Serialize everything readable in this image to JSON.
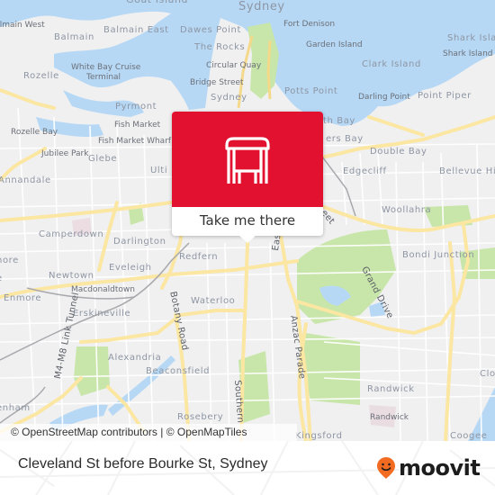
{
  "map": {
    "colors": {
      "water": "#b6d8f5",
      "land": "#f0f0f1",
      "park": "#c8e6a9",
      "major_road": "#fbe6a2",
      "minor_road": "#ffffff",
      "rail": "#a9a9ad",
      "label": "#8e96a3",
      "accent": "#e1112f"
    },
    "labels": {
      "goat_island": "Goat Island",
      "sydney": "Sydney",
      "balmain_west": "Balmain West",
      "balmain": "Balmain",
      "balmain_east": "Balmain East",
      "dawes_point": "Dawes Point",
      "fort_denison": "Fort Denison",
      "shark_island": "Shark Island",
      "shark_island_w": "Shark Island W",
      "the_rocks": "The Rocks",
      "garden_island": "Garden Island",
      "circular_quay": "Circular Quay",
      "white_bay": "White Bay Cruise",
      "terminal": "Terminal",
      "rozelle": "Rozelle",
      "clark_island": "Clark Island",
      "bridge_street": "Bridge Street",
      "sydney_suburb": "Sydney",
      "potts_point": "Potts Point",
      "darling_point": "Darling Point",
      "point_piper": "Point Piper",
      "pyrmont": "Pyrmont",
      "elizabeth_bay": "th Bay",
      "rushcutters_bay": "ers Bay",
      "double_bay": "Double Bay",
      "fish_market": "Fish Market",
      "fish_market_wharf": "Fish Market Wharf",
      "rozelle_bay": "Rozelle Bay",
      "jubilee_park": "Jubilee Park",
      "glebe": "Glebe",
      "ultimo": "Ulti",
      "edgecliff": "Edgecliff",
      "bellevue_hill": "Bellevue Hi",
      "annandale": "Annandale",
      "woollahra": "Woollahra",
      "street_partial": "eet",
      "camperdown": "Camperdown",
      "darlington": "Darlington",
      "bondi_junction": "Bondi Junction",
      "enmore_partial": "nore",
      "redfern": "Redfern",
      "eveleigh": "Eveleigh",
      "newtown": "Newtown",
      "macdonaldtown": "Macdonaldtown",
      "enmore": "Enmore",
      "erskineville": "Erskineville",
      "waterloo": "Waterloo",
      "alexandria": "Alexandria",
      "beaconsfield": "Beaconsfield",
      "randwick": "Randwick",
      "randwick_poi": "Randwick",
      "clovelly_partial": "Clo",
      "tempe_partial": "enham",
      "rosebery": "Rosebery",
      "kingsford": "Kingsford",
      "coogee": "Coogee",
      "grand_drive": "Grand Drive",
      "eastern_distributor": "Eastern Distributor",
      "anzac_parade": "Anzac Parade",
      "botany_road": "Botany Road",
      "southern": "Southern",
      "m4_m8": "M4-M8 Link Tunnel",
      "e_partial": "e"
    }
  },
  "popup": {
    "icon": "bus-stop-shelter-icon",
    "button_label": "Take me there",
    "color": "#e1112f"
  },
  "attribution": {
    "text": "© OpenStreetMap contributors | © OpenMapTiles"
  },
  "footer": {
    "stop_name": "Cleveland St before Bourke St, Sydney",
    "logo_text": "moovit",
    "logo_color": "#f26b21"
  }
}
